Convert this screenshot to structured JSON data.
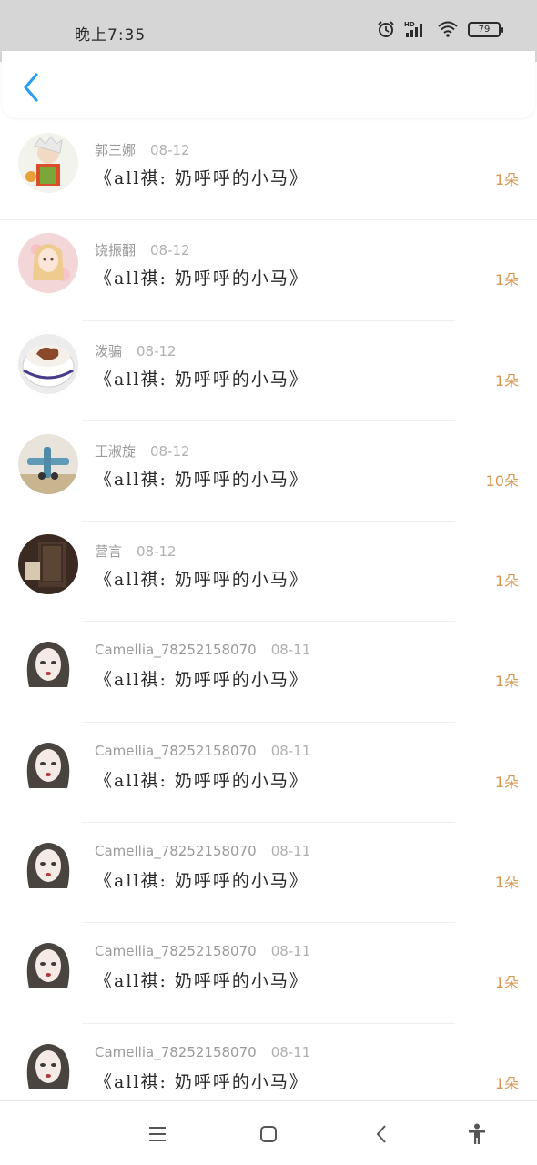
{
  "status_bar": {
    "time": "晚上7:35",
    "battery": "79",
    "network": "HD"
  },
  "items": [
    {
      "name": "郭三娜",
      "date": "08-12",
      "title": "《all祺: 奶呼呼的小马》",
      "count": "1朵",
      "avatar": "cartoon-girl"
    },
    {
      "name": "饶振翻",
      "date": "08-12",
      "title": "《all祺: 奶呼呼的小马》",
      "count": "1朵",
      "avatar": "anime-blonde"
    },
    {
      "name": "泼骗",
      "date": "08-12",
      "title": "《all祺: 奶呼呼的小马》",
      "count": "1朵",
      "avatar": "coffee-cup"
    },
    {
      "name": "王淑旋",
      "date": "08-12",
      "title": "《all祺: 奶呼呼的小马》",
      "count": "10朵",
      "avatar": "toy-plane"
    },
    {
      "name": "营言",
      "date": "08-12",
      "title": "《all祺: 奶呼呼的小马》",
      "count": "1朵",
      "avatar": "dark-room"
    },
    {
      "name": "Camellia_78252158070",
      "date": "08-11",
      "title": "《all祺: 奶呼呼的小马》",
      "count": "1朵",
      "avatar": "girl-portrait"
    },
    {
      "name": "Camellia_78252158070",
      "date": "08-11",
      "title": "《all祺: 奶呼呼的小马》",
      "count": "1朵",
      "avatar": "girl-portrait"
    },
    {
      "name": "Camellia_78252158070",
      "date": "08-11",
      "title": "《all祺: 奶呼呼的小马》",
      "count": "1朵",
      "avatar": "girl-portrait"
    },
    {
      "name": "Camellia_78252158070",
      "date": "08-11",
      "title": "《all祺: 奶呼呼的小马》",
      "count": "1朵",
      "avatar": "girl-portrait"
    },
    {
      "name": "Camellia_78252158070",
      "date": "08-11",
      "title": "《all祺: 奶呼呼的小马》",
      "count": "1朵",
      "avatar": "girl-portrait"
    }
  ],
  "colors": {
    "accent_blue": "#2a9df4",
    "count_orange": "#d9964f"
  },
  "nav": {
    "icons": [
      "menu-icon",
      "home-square-icon",
      "back-triangle-icon",
      "accessibility-icon"
    ]
  }
}
